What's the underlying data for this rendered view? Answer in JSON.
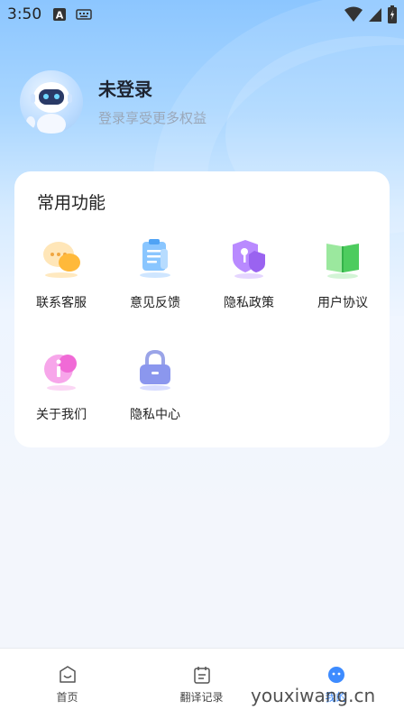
{
  "status_bar": {
    "time": "3:50"
  },
  "profile": {
    "title": "未登录",
    "subtitle": "登录享受更多权益"
  },
  "functions": {
    "title": "常用功能",
    "items": [
      {
        "label": "联系客服",
        "icon": "customer-service-icon"
      },
      {
        "label": "意见反馈",
        "icon": "feedback-icon"
      },
      {
        "label": "隐私政策",
        "icon": "privacy-policy-icon"
      },
      {
        "label": "用户协议",
        "icon": "user-agreement-icon"
      },
      {
        "label": "关于我们",
        "icon": "about-us-icon"
      },
      {
        "label": "隐私中心",
        "icon": "privacy-center-icon"
      }
    ]
  },
  "tabbar": {
    "items": [
      {
        "label": "首页",
        "icon": "home-icon"
      },
      {
        "label": "翻译记录",
        "icon": "calendar-icon"
      },
      {
        "label": "我的",
        "icon": "profile-icon",
        "active": true
      }
    ]
  },
  "watermark": "youxiwang.cn",
  "colors": {
    "accent": "#3d8bff",
    "header_blue": "#8cc6ff"
  }
}
